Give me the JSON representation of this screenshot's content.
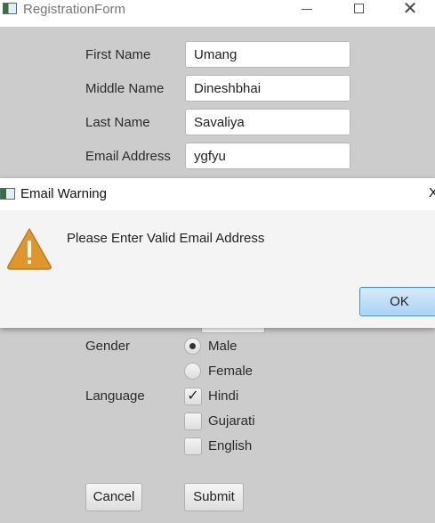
{
  "window": {
    "title": "RegistrationForm",
    "controls": [
      "minimize",
      "maximize",
      "close"
    ]
  },
  "form": {
    "first_name_label": "First Name",
    "first_name_value": "Umang",
    "middle_name_label": "Middle Name",
    "middle_name_value": "Dineshbhai",
    "last_name_label": "Last Name",
    "last_name_value": "Savaliya",
    "email_label": "Email Address",
    "email_value": "ygfyu",
    "gender_label": "Gender",
    "gender_options": [
      {
        "label": "Male",
        "checked": true
      },
      {
        "label": "Female",
        "checked": false
      }
    ],
    "language_label": "Language",
    "language_options": [
      {
        "label": "Hindi",
        "checked": true
      },
      {
        "label": "Gujarati",
        "checked": false
      },
      {
        "label": "English",
        "checked": false
      }
    ],
    "cancel_label": "Cancel",
    "submit_label": "Submit"
  },
  "dialog": {
    "title": "Email Warning",
    "close_glyph": "X",
    "icon": "warning-icon",
    "message": "Please Enter Valid Email Address",
    "ok_label": "OK"
  },
  "colors": {
    "background": "#cccccc",
    "dialog_background": "#f4f4f4",
    "warning_icon": "#e0962c",
    "ok_button": "#a9d2f4"
  }
}
